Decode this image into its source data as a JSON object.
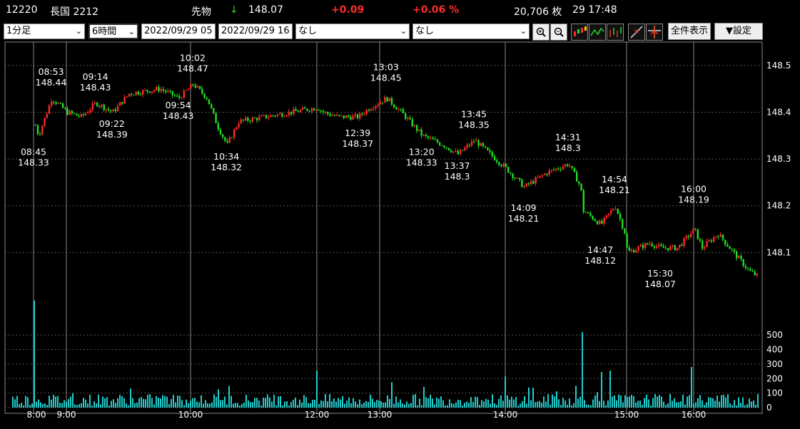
{
  "header": {
    "code": "12220",
    "name": "長国 2212",
    "kind": "先物",
    "arrow": "↓",
    "price": "148.07",
    "change": "+0.09",
    "change_pct": "+0.06 %",
    "volume": "20,706 枚",
    "time": "29 17:48"
  },
  "toolbar": {
    "interval": "1分足",
    "span": "6時間",
    "date_from": "2022/09/29 05",
    "date_to": "2022/09/29 16",
    "indicator1": "なし",
    "indicator2": "なし",
    "full_view": "全件表示",
    "settings": "▼設定"
  },
  "colors": {
    "up": "#ff2a2a",
    "down": "#22dd22",
    "volume": "#22cccc",
    "grid": "#555555",
    "session_line": "#888888"
  },
  "chart_data": {
    "type": "candlestick",
    "y_ticks": [
      "148.1",
      "148.2",
      "148.3",
      "148.4",
      "148.5"
    ],
    "ylim": [
      148.0,
      148.55
    ],
    "volume_ticks": [
      "0",
      "100",
      "200",
      "300",
      "400",
      "500"
    ],
    "volume_lim": [
      0,
      550
    ],
    "x_ticks": [
      {
        "label": "8:00",
        "t": "08:00"
      },
      {
        "label": "9:00",
        "t": "09:00"
      },
      {
        "label": "10:00",
        "t": "10:00"
      },
      {
        "label": "12:00",
        "t": "12:00"
      },
      {
        "label": "13:00",
        "t": "13:00"
      },
      {
        "label": "14:00",
        "t": "14:00"
      },
      {
        "label": "15:00",
        "t": "15:00"
      },
      {
        "label": "16:00",
        "t": "16:00"
      }
    ],
    "session_lines": [
      "08:45",
      "09:00",
      "10:00",
      "12:00",
      "13:00",
      "14:00",
      "15:00",
      "16:00"
    ],
    "annotations": [
      {
        "time": "08:45",
        "price": "148.33",
        "pos": "below"
      },
      {
        "time": "08:53",
        "price": "148.44",
        "pos": "above"
      },
      {
        "time": "09:14",
        "price": "148.43",
        "pos": "above"
      },
      {
        "time": "09:22",
        "price": "148.39",
        "pos": "below"
      },
      {
        "time": "09:54",
        "price": "148.43",
        "pos": "below"
      },
      {
        "time": "10:02",
        "price": "148.47",
        "pos": "above"
      },
      {
        "time": "10:34",
        "price": "148.32",
        "pos": "below"
      },
      {
        "time": "12:39",
        "price": "148.37",
        "pos": "below"
      },
      {
        "time": "13:03",
        "price": "148.45",
        "pos": "above"
      },
      {
        "time": "13:20",
        "price": "148.33",
        "pos": "below"
      },
      {
        "time": "13:37",
        "price": "148.3",
        "pos": "below"
      },
      {
        "time": "13:45",
        "price": "148.35",
        "pos": "above"
      },
      {
        "time": "14:09",
        "price": "148.21",
        "pos": "below"
      },
      {
        "time": "14:31",
        "price": "148.3",
        "pos": "above"
      },
      {
        "time": "14:47",
        "price": "148.12",
        "pos": "below"
      },
      {
        "time": "14:54",
        "price": "148.21",
        "pos": "above"
      },
      {
        "time": "15:30",
        "price": "148.07",
        "pos": "below"
      },
      {
        "time": "16:00",
        "price": "148.19",
        "pos": "above"
      }
    ],
    "close_path": [
      [
        "07:59",
        148.46
      ],
      [
        "08:45",
        148.38
      ],
      [
        "08:47",
        148.35
      ],
      [
        "08:53",
        148.43
      ],
      [
        "09:00",
        148.4
      ],
      [
        "09:07",
        148.39
      ],
      [
        "09:14",
        148.42
      ],
      [
        "09:22",
        148.4
      ],
      [
        "09:30",
        148.44
      ],
      [
        "09:45",
        148.45
      ],
      [
        "09:54",
        148.43
      ],
      [
        "10:02",
        148.46
      ],
      [
        "10:15",
        148.43
      ],
      [
        "10:25",
        148.37
      ],
      [
        "10:34",
        148.33
      ],
      [
        "10:45",
        148.38
      ],
      [
        "12:00",
        148.41
      ],
      [
        "12:05",
        148.4
      ],
      [
        "12:20",
        148.39
      ],
      [
        "12:39",
        148.39
      ],
      [
        "12:50",
        148.41
      ],
      [
        "13:03",
        148.43
      ],
      [
        "13:10",
        148.4
      ],
      [
        "13:20",
        148.35
      ],
      [
        "13:30",
        148.33
      ],
      [
        "13:37",
        148.31
      ],
      [
        "13:45",
        148.34
      ],
      [
        "13:55",
        148.3
      ],
      [
        "14:00",
        148.28
      ],
      [
        "14:09",
        148.24
      ],
      [
        "14:20",
        148.27
      ],
      [
        "14:31",
        148.29
      ],
      [
        "14:37",
        148.24
      ],
      [
        "14:38",
        148.19
      ],
      [
        "14:47",
        148.16
      ],
      [
        "14:54",
        148.2
      ],
      [
        "14:59",
        148.14
      ],
      [
        "15:00",
        148.1
      ],
      [
        "15:10",
        148.11
      ],
      [
        "15:20",
        148.12
      ],
      [
        "15:30",
        148.11
      ],
      [
        "15:45",
        148.11
      ],
      [
        "16:00",
        148.15
      ],
      [
        "16:05",
        148.11
      ],
      [
        "16:15",
        148.14
      ],
      [
        "16:25",
        148.1
      ],
      [
        "16:35",
        148.06
      ],
      [
        "16:40",
        148.05
      ]
    ],
    "volume_spikes": [
      {
        "time": "08:45",
        "value": 410
      },
      {
        "time": "12:00",
        "value": 255
      },
      {
        "time": "14:00",
        "value": 215
      },
      {
        "time": "14:38",
        "value": 520
      },
      {
        "time": "14:47",
        "value": 245
      },
      {
        "time": "14:51",
        "value": 255
      },
      {
        "time": "15:57",
        "value": 280
      },
      {
        "time": "14:35",
        "value": 150
      },
      {
        "time": "13:05",
        "value": 175
      }
    ],
    "volume_base": 90
  }
}
